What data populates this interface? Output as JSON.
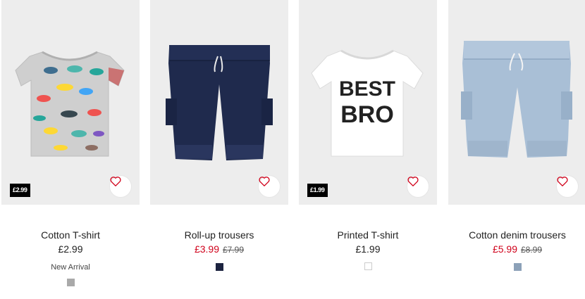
{
  "products": [
    {
      "name": "Cotton T-shirt",
      "price": "£2.99",
      "old_price": "",
      "badge_text": "£2.99",
      "label": "New Arrival",
      "swatch_color": "#a9a9a9",
      "image": "grey-dinosaur-t-shirt"
    },
    {
      "name": "Roll-up trousers",
      "price": "£3.99",
      "old_price": "£7.99",
      "badge_text": "",
      "label": "",
      "swatch_color": "#1c2340",
      "image": "navy-roll-up-shorts"
    },
    {
      "name": "Printed T-shirt",
      "price": "£1.99",
      "old_price": "",
      "badge_text": "£1.99",
      "label": "",
      "swatch_color": "#ffffff",
      "image": "white-best-bro-t-shirt",
      "print_line1": "BEST",
      "print_line2": "BRO"
    },
    {
      "name": "Cotton denim trousers",
      "price": "£5.99",
      "old_price": "£8.99",
      "badge_text": "",
      "label": "",
      "swatch_color": "#8ca1b8",
      "image": "light-denim-shorts"
    }
  ],
  "colors": {
    "sale_red": "#d0021b",
    "heart": "#d0021b",
    "image_background": "#ededed"
  },
  "icons": {
    "favourite": "heart-icon"
  }
}
